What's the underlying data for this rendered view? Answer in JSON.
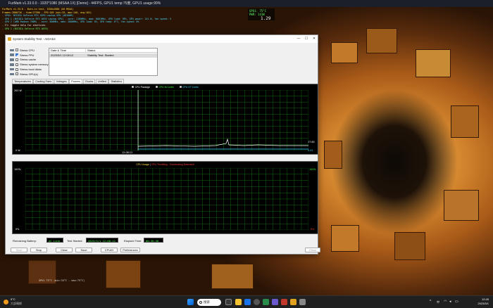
{
  "furmark": {
    "titlebar": "FurMark v1.33.0.0 - 1920*1080 (MSAA 1X) [Demo] - 44FPS, GPU1 temp:75度, GPU1 usage:99%",
    "lines": [
      {
        "text": "FurMark v1.33.0 - Burn-in test, 1920x1080 (0X MSAA)",
        "color": "y"
      },
      {
        "text": "Frames:2880716 - time:27390 - FPS:105 (min:33, max:146, avg:101)",
        "color": "y"
      },
      {
        "text": "- GPU1: NVIDIA GeForce RTX 4070 Laptop GPU (AD106M)",
        "color": "c"
      },
      {
        "text": "- GPU 1 (NVIDIA GeForce RTX 4070 Laptop GPU) - core: 2160MHz, mem: 8001MHz, GPU load: 99%, GPU power: 141 W, fan speed: 53%",
        "color": "c"
      },
      {
        "text": "- GPU 2 (AMD Radeon 780M) - core: 800MHz, mem: 2800MHz, GPU load: 0%, GPU temp: 0°C, fan speed: 0%",
        "color": "c"
      },
      {
        "text": "- F1: toggle help for shortcuts",
        "color": "w"
      },
      {
        "text": "- GPU 1 (NVIDIA GeForce RTX 4070)",
        "color": "g"
      }
    ],
    "hud_lines": [
      "GPU1: 75°C",
      "PWR: 141W"
    ],
    "hud_value": "1.29"
  },
  "window": {
    "title": "System Stability Test - AIDA64",
    "controls": {
      "minimize": "—",
      "maximize": "☐",
      "close": "✕"
    }
  },
  "stress_options": [
    {
      "label": "Stress CPU",
      "checked": false,
      "icon": "cpu-icon"
    },
    {
      "label": "Stress FPU",
      "checked": true,
      "icon": "fpu-icon"
    },
    {
      "label": "Stress cache",
      "checked": false,
      "icon": "cache-icon"
    },
    {
      "label": "Stress system memory",
      "checked": false,
      "icon": "memory-icon"
    },
    {
      "label": "Stress local disks",
      "checked": false,
      "icon": "disk-icon"
    },
    {
      "label": "Stress GPU(s)",
      "checked": false,
      "icon": "gpu-icon"
    }
  ],
  "log_table": {
    "headers": [
      "Date & Time",
      "Status"
    ],
    "rows": [
      [
        "2023/3/1 12:08:12",
        "Stability Test: Started"
      ]
    ]
  },
  "tabs": [
    "Temperatures",
    "Cooling Fans",
    "Voltages",
    "Powers",
    "Clocks",
    "Unified",
    "Statistics"
  ],
  "active_tab": "Powers",
  "power_chart": {
    "legend": [
      {
        "label": "CPU Package",
        "color": "#ffffff"
      },
      {
        "label": "CPU IA Cores",
        "color": "#3dff3d"
      },
      {
        "label": "CPU GT Cores",
        "color": "#3fd9ff"
      }
    ],
    "y_top": "200 W",
    "y_bottom": "0 W",
    "x_label": "12:08:12",
    "right_value_top": "27.80",
    "right_value_bottom": "0.01"
  },
  "usage_chart": {
    "title_a": "CPU Usage",
    "title_sep": " | ",
    "title_b": "CPU Throttling - Overheating Detected!",
    "y_top": "100%",
    "y_bottom": "0%",
    "right_top": "100%",
    "right_bottom": "0%"
  },
  "status": {
    "battery_label": "Remaining Battery:",
    "battery_value": "AC Line",
    "started_label": "Test Started:",
    "started_value": "2023/3/1 12:08:12",
    "elapsed_label": "Elapsed Time:",
    "elapsed_value": "00:36:56"
  },
  "buttons": {
    "start": "Start",
    "stop": "Stop",
    "clear": "Clear",
    "save": "Save",
    "cpuid": "CPUID",
    "preferences": "Preferences",
    "close": "Close"
  },
  "bottom_line": "GPU1 75°C (min:34°C - max:75°C)",
  "taskbar": {
    "weather_temp": "9°C",
    "weather_desc": "大部晴朗",
    "search_label": "搜索",
    "time": "12:45",
    "date": "2023/3/1",
    "input_method": "中"
  }
}
